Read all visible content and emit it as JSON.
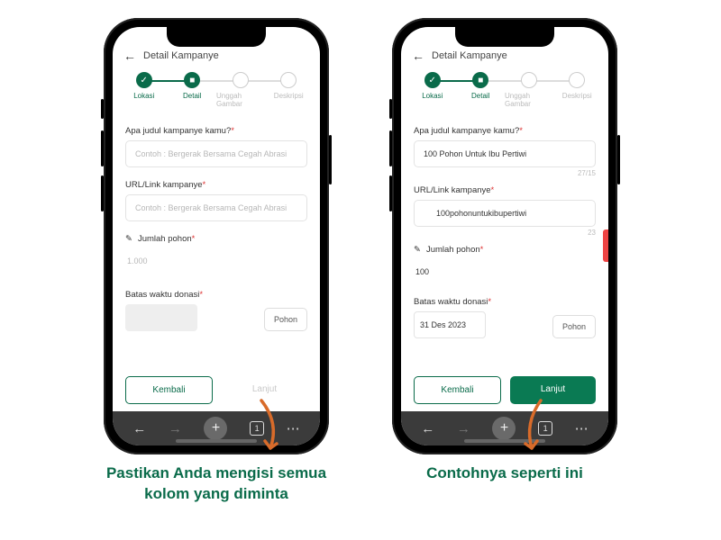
{
  "header_title": "Detail Kampanye",
  "steps": {
    "s1": {
      "label": "Lokasi",
      "glyph": "✓"
    },
    "s2": {
      "label": "Detail",
      "glyph": "■"
    },
    "s3": {
      "label": "Unggah Gambar",
      "glyph": ""
    },
    "s4": {
      "label": "Deskripsi",
      "glyph": ""
    }
  },
  "fields": {
    "title_label": "Apa judul kampanye kamu?",
    "title_placeholder": "Contoh : Bergerak Bersama Cegah Abrasi",
    "url_label": "URL/Link kampanye",
    "url_placeholder": "Contoh : Bergerak Bersama Cegah Abrasi",
    "trees_label": "Jumlah pohon",
    "trees_prefix": "✎",
    "trees_placeholder": "1.000",
    "deadline_label": "Batas waktu donasi",
    "unit_label": "Pohon"
  },
  "filled": {
    "title_value": "100 Pohon Untuk Ibu Pertiwi",
    "title_counter": "27/15",
    "url_value": "100pohonuntukibupertiwi",
    "url_counter": "23",
    "trees_value": "100",
    "deadline_value": "31 Des 2023"
  },
  "buttons": {
    "back": "Kembali",
    "next": "Lanjut"
  },
  "browser": {
    "back": "←",
    "forward": "→",
    "plus": "+",
    "tabs": "1",
    "more": "⋯"
  },
  "captions": {
    "left": "Pastikan Anda mengisi semua kolom yang diminta",
    "right": "Contohnya seperti ini"
  }
}
